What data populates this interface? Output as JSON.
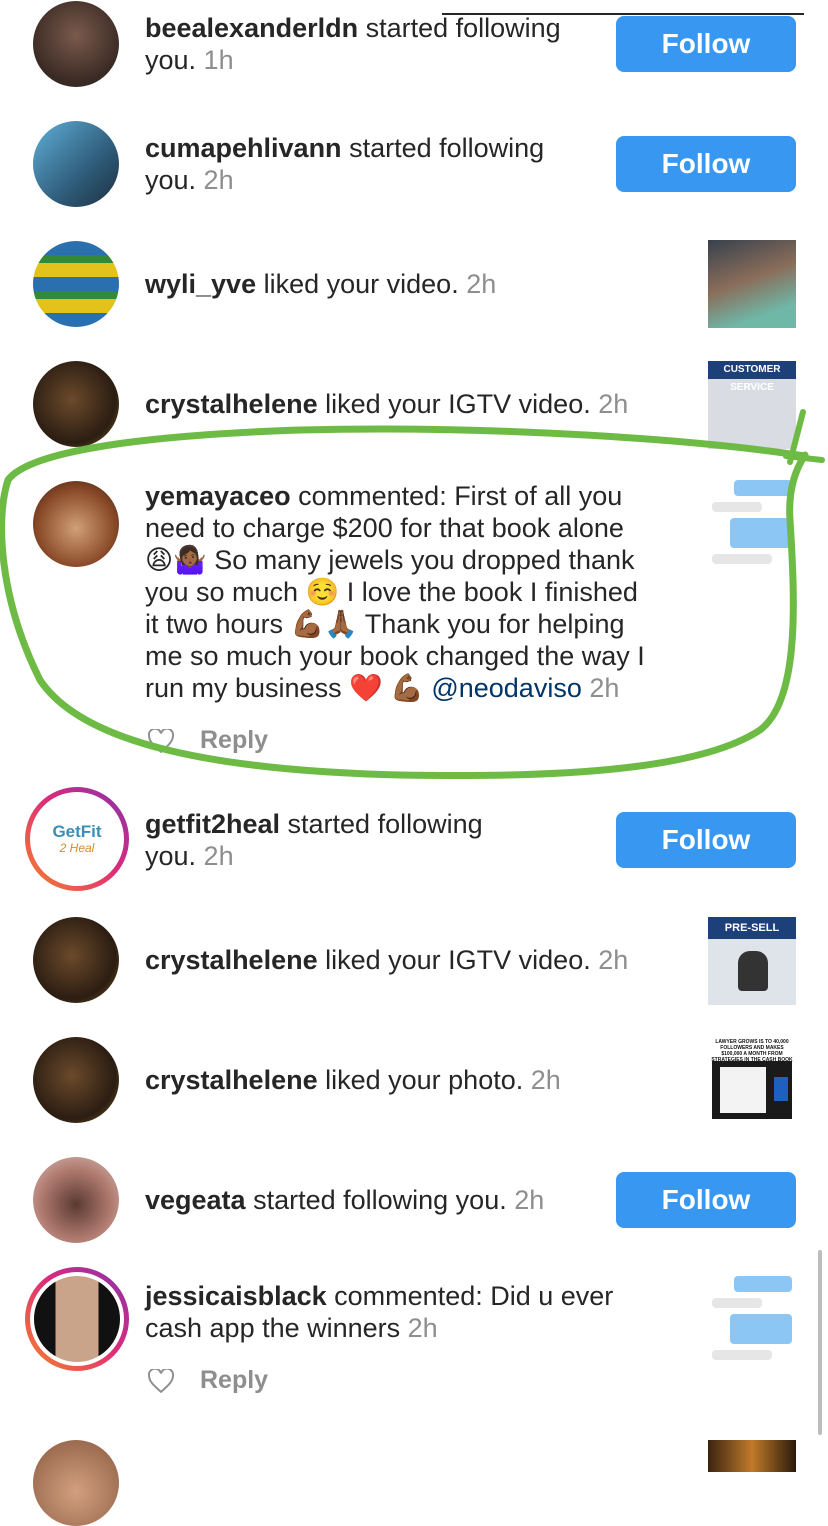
{
  "colors": {
    "follow_blue": "#3897f0",
    "highlight_green": "#6dbb45",
    "muted": "#8e8e8e"
  },
  "notifications": [
    {
      "user": "beealexanderldn",
      "action": " started following",
      "action2": "you.",
      "time": " 1h",
      "button": "Follow"
    },
    {
      "user": "cumapehlivann",
      "action": " started following",
      "action2": "you.",
      "time": " 2h",
      "button": "Follow"
    },
    {
      "user": "wyli_yve",
      "action": " liked your video.",
      "time": " 2h"
    },
    {
      "user": "crystalhelene",
      "action": " liked your IGTV video.",
      "time": " 2h",
      "thumb_caption": "CUSTOMER SERVICE"
    },
    {
      "user": "yemayaceo",
      "lines": [
        " commented: First of all you",
        "need to charge $200 for that book alone",
        "😩🤷🏾‍♀️ So many jewels you dropped thank",
        "you so much ☺️ I love the book I finished",
        "it two hours 💪🏾🙏🏾 Thank you for helping",
        "me so much your book changed the way I",
        "run my business ❤️ 💪🏾 "
      ],
      "mention": "@neodaviso",
      "time": " 2h",
      "reply": "Reply"
    },
    {
      "user": "getfit2heal",
      "action": " started following",
      "action2": "you.",
      "time": " 2h",
      "button": "Follow",
      "avatar_text1": "GetFit",
      "avatar_text2": "2 Heal"
    },
    {
      "user": "crystalhelene",
      "action": " liked your IGTV video.",
      "time": " 2h",
      "thumb_caption": "PRE-SELL"
    },
    {
      "user": "crystalhelene",
      "action": " liked your photo.",
      "time": " 2h",
      "thumb_caption": "LAWYER GROWS IS TO 40,000 FOLLOWERS AND MAKES $100,000 A MONTH FROM STRATEGIES IN THE CASH BOOK"
    },
    {
      "user": "vegeata",
      "action": " started following you.",
      "time": " 2h",
      "button": "Follow"
    },
    {
      "user": "jessicaisblack",
      "lines": [
        " commented: Did u ever",
        "cash app the winners"
      ],
      "time": " 2h",
      "reply": "Reply"
    }
  ]
}
